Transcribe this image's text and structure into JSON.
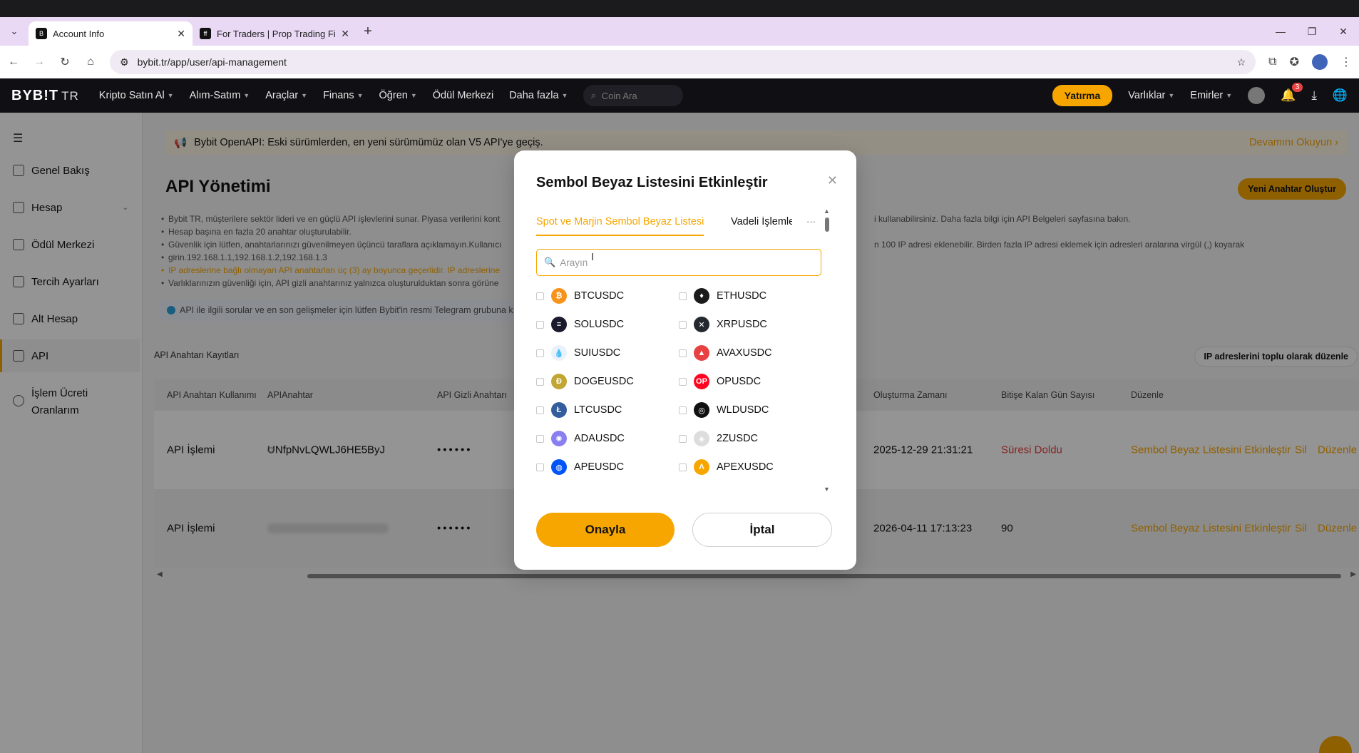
{
  "browser": {
    "tabs": [
      {
        "title": "Account Info",
        "active": true
      },
      {
        "title": "For Traders | Prop Trading Firm",
        "active": false
      }
    ],
    "url": "bybit.tr/app/user/api-management"
  },
  "header": {
    "logo": "BYB!T",
    "logo_suffix": "TR",
    "menu": [
      "Kripto Satın Al",
      "Alım-Satım",
      "Araçlar",
      "Finans",
      "Öğren",
      "Ödül Merkezi",
      "Daha fazla"
    ],
    "search_placeholder": "Coin Ara",
    "deposit": "Yatırma",
    "assets": "Varlıklar",
    "orders": "Emirler",
    "notification_count": "3"
  },
  "sidebar": {
    "items": [
      {
        "label": "Genel Bakış"
      },
      {
        "label": "Hesap"
      },
      {
        "label": "Ödül Merkezi"
      },
      {
        "label": "Tercih Ayarları"
      },
      {
        "label": "Alt Hesap"
      },
      {
        "label": "API"
      },
      {
        "label": "İşlem Ücreti Oranlarım"
      }
    ]
  },
  "main": {
    "notice": "Bybit OpenAPI: Eski sürümlerden, en yeni sürümümüz olan V5 API'ye geçiş.",
    "notice_more": "Devamını Okuyun",
    "title": "API Yönetimi",
    "new_key": "Yeni Anahtar Oluştur",
    "info": [
      "Bybit TR, müşterilere sektör lideri ve en güçlü API işlevlerini sunar. Piyasa verilerini kont",
      "Hesap başına en fazla 20 anahtar oluşturulabilir.",
      "Güvenlik için lütfen, anahtarlarınızı güvenilmeyen üçüncü taraflara açıklamayın.Kullanıcı",
      "girin.192.168.1.1,192.168.1.2,192.168.1.3",
      "IP adreslerine bağlı olmayan API anahtarları üç (3) ay boyunca geçerlidir. IP adreslerine",
      "Varlıklarınızın güvenliği için, API gizli anahtarınız yalnızca oluşturulduktan sonra görüne"
    ],
    "info_right_1": "i kullanabilirsiniz. Daha fazla bilgi için API Belgeleri sayfasına bakın.",
    "info_right_2": "n 100 IP adresi eklenebilir. Birden fazla IP adresi eklemek için adresleri aralarına virgül (,) koyarak",
    "telegram": "API ile ilgili sorular ve en son gelişmeler için lütfen Bybit'in resmi Telegram grubuna k",
    "records_label": "API Anahtarı Kayıtları",
    "bulk_edit": "IP adreslerini toplu olarak düzenle",
    "table": {
      "headers": [
        "API Anahtarı Kullanımı",
        "APIAnahtar",
        "API Gizli Anahtarı",
        "Oluşturma Zamanı",
        "Bitişe Kalan Gün Sayısı",
        "Düzenle"
      ],
      "rows": [
        {
          "usage": "API İşlemi",
          "key": "UNfpNvLQWLJ6HE5ByJ",
          "secret": "••••••",
          "created": "2025-12-29 21:31:21",
          "days": "Süresi Doldu",
          "act1": "Sembol Beyaz Listesini Etkinleştir",
          "act2": "Sil",
          "act3": "Düzenle"
        },
        {
          "usage": "API İşlemi",
          "key": "",
          "secret": "••••••",
          "created": "2026-04-11 17:13:23",
          "days": "90",
          "act1": "Sembol Beyaz Listesini Etkinleştir",
          "act2": "Sil",
          "act3": "Düzenle"
        }
      ]
    }
  },
  "modal": {
    "title": "Sembol Beyaz Listesini Etkinleştir",
    "tab_active": "Spot ve Marjin Sembol Beyaz Listesi",
    "tab_other": "Vadeli İşlemler",
    "tab_more": "···",
    "search_placeholder": "Arayın",
    "coins": [
      {
        "name": "BTCUSDC",
        "color": "#f7931a",
        "glyph": "₿"
      },
      {
        "name": "ETHUSDC",
        "color": "#1b1b1b",
        "glyph": "♦"
      },
      {
        "name": "SOLUSDC",
        "color": "#1b1b2e",
        "glyph": "≡"
      },
      {
        "name": "XRPUSDC",
        "color": "#23292f",
        "glyph": "✕"
      },
      {
        "name": "SUIUSDC",
        "color": "#e8f1fc",
        "glyph": "💧"
      },
      {
        "name": "AVAXUSDC",
        "color": "#e84142",
        "glyph": "▲"
      },
      {
        "name": "DOGEUSDC",
        "color": "#c2a633",
        "glyph": "Ð"
      },
      {
        "name": "OPUSDC",
        "color": "#ff0420",
        "glyph": "OP"
      },
      {
        "name": "LTCUSDC",
        "color": "#345d9d",
        "glyph": "Ł"
      },
      {
        "name": "WLDUSDC",
        "color": "#111111",
        "glyph": "◎"
      },
      {
        "name": "ADAUSDC",
        "color": "#8a7ff0",
        "glyph": "✺"
      },
      {
        "name": "2ZUSDC",
        "color": "#dddddd",
        "glyph": "◈"
      },
      {
        "name": "APEUSDC",
        "color": "#0054f9",
        "glyph": "◍"
      },
      {
        "name": "APEXUSDC",
        "color": "#f7a600",
        "glyph": "Λ"
      }
    ],
    "confirm": "Onayla",
    "cancel": "İptal"
  }
}
